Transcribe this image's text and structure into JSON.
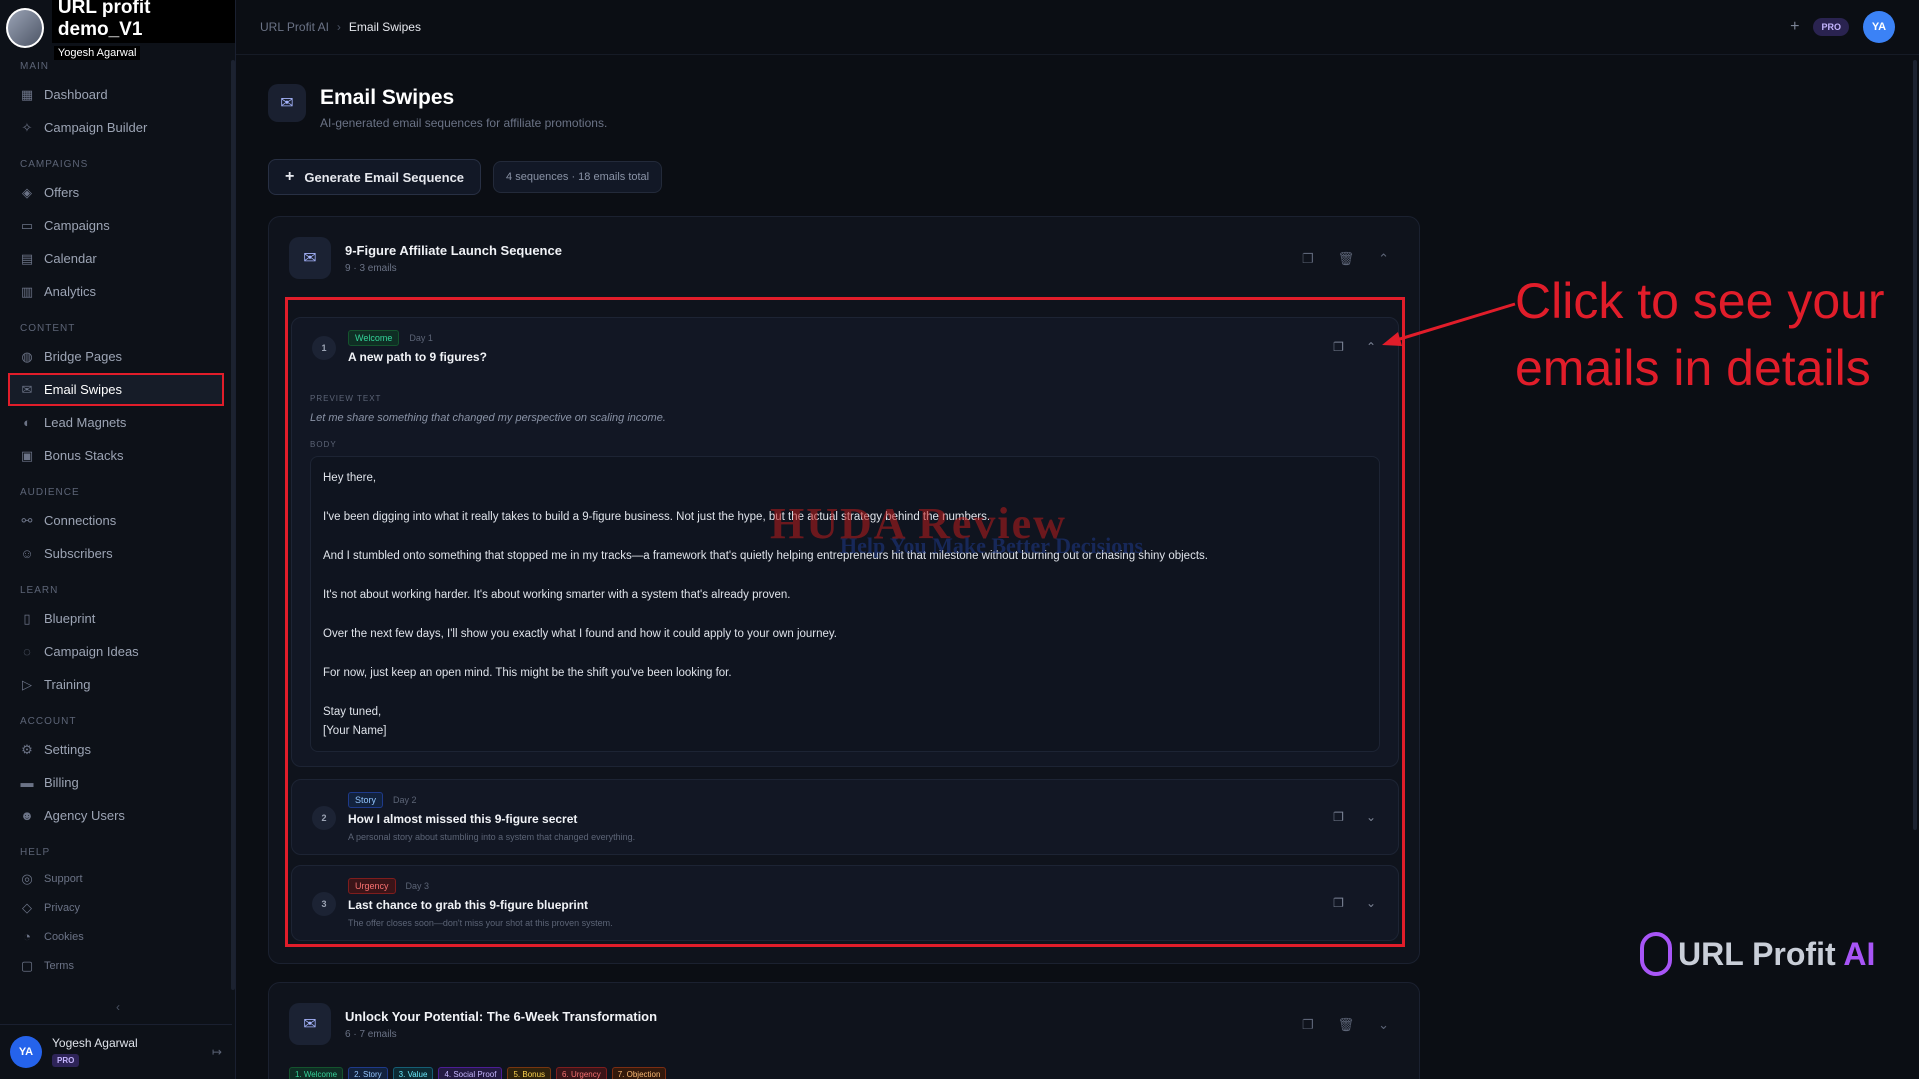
{
  "brand": {
    "title": "URL profit demo_V1",
    "subtitle": "Yogesh Agarwal"
  },
  "topbar": {
    "crumb_root": "URL Profit AI",
    "crumb_current": "Email Swipes",
    "pro": "PRO",
    "avatar": "YA"
  },
  "sidebar": {
    "sections": [
      {
        "label": "MAIN",
        "items": [
          {
            "label": "Dashboard",
            "icon": "grid-icon"
          },
          {
            "label": "Campaign Builder",
            "icon": "wand-icon"
          }
        ]
      },
      {
        "label": "CAMPAIGNS",
        "items": [
          {
            "label": "Offers",
            "icon": "tag-icon"
          },
          {
            "label": "Campaigns",
            "icon": "folder-icon"
          },
          {
            "label": "Calendar",
            "icon": "calendar-icon"
          },
          {
            "label": "Analytics",
            "icon": "bar-chart-icon"
          }
        ]
      },
      {
        "label": "CONTENT",
        "items": [
          {
            "label": "Bridge Pages",
            "icon": "globe-icon"
          },
          {
            "label": "Email Swipes",
            "icon": "mail-icon",
            "active": true
          },
          {
            "label": "Lead Magnets",
            "icon": "magnet-icon"
          },
          {
            "label": "Bonus Stacks",
            "icon": "gift-icon"
          }
        ]
      },
      {
        "label": "AUDIENCE",
        "items": [
          {
            "label": "Connections",
            "icon": "link-icon"
          },
          {
            "label": "Subscribers",
            "icon": "users-icon"
          }
        ]
      },
      {
        "label": "LEARN",
        "items": [
          {
            "label": "Blueprint",
            "icon": "book-icon"
          },
          {
            "label": "Campaign Ideas",
            "icon": "lightbulb-icon"
          },
          {
            "label": "Training",
            "icon": "video-icon"
          }
        ]
      },
      {
        "label": "ACCOUNT",
        "items": [
          {
            "label": "Settings",
            "icon": "gear-icon"
          },
          {
            "label": "Billing",
            "icon": "card-icon"
          },
          {
            "label": "Agency Users",
            "icon": "user-group-icon"
          }
        ]
      },
      {
        "label": "HELP",
        "items": [
          {
            "label": "Support",
            "icon": "lifebuoy-icon",
            "small": true
          },
          {
            "label": "Privacy",
            "icon": "shield-icon",
            "small": true
          },
          {
            "label": "Cookies",
            "icon": "cookie-icon",
            "small": true
          },
          {
            "label": "Terms",
            "icon": "document-icon",
            "small": true
          }
        ]
      }
    ],
    "user": {
      "avatar": "YA",
      "name": "Yogesh Agarwal",
      "badge": "PRO"
    }
  },
  "page": {
    "title": "Email Swipes",
    "subtitle": "AI-generated email sequences for affiliate promotions.",
    "generate_label": "Generate Email Sequence",
    "stats": "4 sequences · 18 emails total"
  },
  "sequence1": {
    "title": "9-Figure Affiliate Launch Sequence",
    "meta": "9 · 3 emails",
    "emails": [
      {
        "num": "1",
        "tag": "Welcome",
        "day": "Day 1",
        "subject": "A new path to 9 figures?",
        "preview_label": "PREVIEW TEXT",
        "preview": "Let me share something that changed my perspective on scaling income.",
        "body_label": "BODY",
        "body": [
          "Hey there,",
          "I've been digging into what it really takes to build a 9-figure business. Not just the hype, but the actual strategy behind the numbers.",
          "And I stumbled onto something that stopped me in my tracks—a framework that's quietly helping entrepreneurs hit that milestone without burning out or chasing shiny objects.",
          "It's not about working harder. It's about working smarter with a system that's already proven.",
          "Over the next few days, I'll show you exactly what I found and how it could apply to your own journey.",
          "For now, just keep an open mind. This might be the shift you've been looking for.",
          "Stay tuned,",
          "[Your Name]"
        ]
      },
      {
        "num": "2",
        "tag": "Story",
        "day": "Day 2",
        "subject": "How I almost missed this 9-figure secret",
        "desc": "A personal story about stumbling into a system that changed everything."
      },
      {
        "num": "3",
        "tag": "Urgency",
        "day": "Day 3",
        "subject": "Last chance to grab this 9-figure blueprint",
        "desc": "The offer closes soon—don't miss your shot at this proven system."
      }
    ]
  },
  "sequence2": {
    "title": "Unlock Your Potential: The 6-Week Transformation",
    "meta": "6 · 7 emails",
    "chips": [
      "1. Welcome",
      "2. Story",
      "3. Value",
      "4. Social Proof",
      "5. Bonus",
      "6. Urgency",
      "7. Objection"
    ]
  },
  "annotation": {
    "line1": "Click to see your",
    "line2": "emails in details"
  },
  "watermark": {
    "main": "HUDA Review",
    "sub": "Help You Make Better Decisions"
  },
  "logo": {
    "text": "URL Profit",
    "ai": "AI"
  },
  "colors": {
    "accent": "#e11d2a",
    "background": "#0b0e14",
    "brand_purple": "#a855f7"
  }
}
